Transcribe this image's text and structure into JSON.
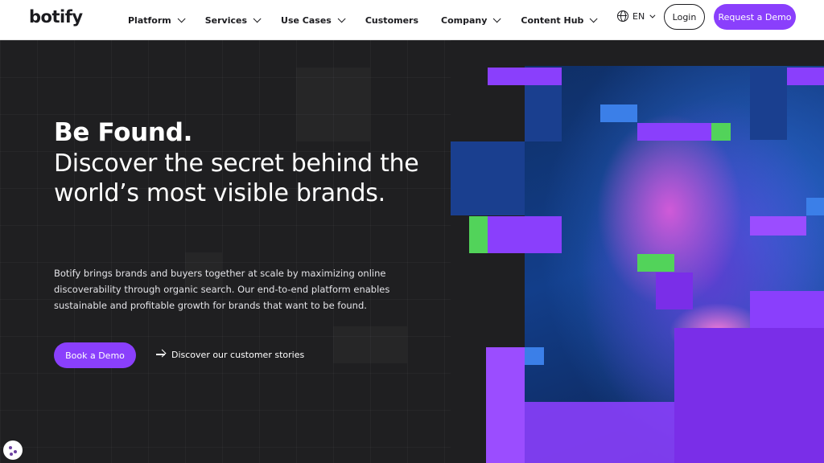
{
  "header": {
    "logo": "botify",
    "nav": [
      {
        "label": "Platform",
        "dropdown": true
      },
      {
        "label": "Services",
        "dropdown": true
      },
      {
        "label": "Use Cases",
        "dropdown": true
      },
      {
        "label": "Customers",
        "dropdown": false
      },
      {
        "label": "Company",
        "dropdown": true
      },
      {
        "label": "Content Hub",
        "dropdown": true
      }
    ],
    "language": "EN",
    "login_label": "Login",
    "request_demo_label": "Request a Demo"
  },
  "hero": {
    "title": "Be Found.",
    "subtitle": "Discover the secret behind the world’s most visible brands.",
    "description": "Botify brings brands and buyers together at scale by maximizing online discoverability through organic search. Our end-to-end platform enables sustainable and profitable growth for brands that want to be found.",
    "primary_cta": "Book a Demo",
    "secondary_cta": "Discover our customer stories"
  },
  "colors": {
    "accent": "#8a3ffc",
    "background": "#1f1f21",
    "header_bg": "#ffffff"
  },
  "icons": {
    "language": "globe-icon",
    "secondary_cta": "arrow-right-icon",
    "cookie": "cookie-icon"
  }
}
